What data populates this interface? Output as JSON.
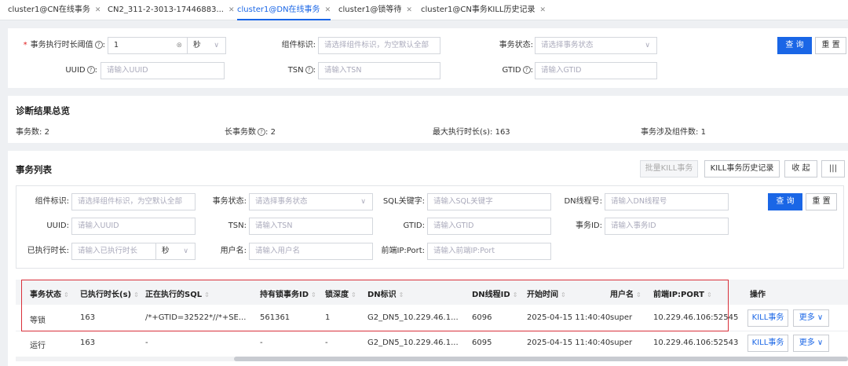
{
  "tabs": [
    {
      "label": "cluster1@CN在线事务"
    },
    {
      "label": "CN2_311-2-3013-17446883..."
    },
    {
      "label": "cluster1@DN在线事务"
    },
    {
      "label": "cluster1@锁等待"
    },
    {
      "label": "cluster1@CN事务KILL历史记录"
    }
  ],
  "top_filter": {
    "threshold_label": "事务执行时长阈值",
    "threshold_value": "1",
    "unit_value": "秒",
    "component_label": "组件标识:",
    "component_placeholder": "请选择组件标识，为空默认全部",
    "status_label": "事务状态:",
    "status_placeholder": "请选择事务状态",
    "query_label": "查 询",
    "reset_label": "重 置",
    "uuid_label": "UUID",
    "uuid_placeholder": "请输入UUID",
    "tsn_label": "TSN",
    "tsn_placeholder": "请输入TSN",
    "gtid_label": "GTID",
    "gtid_placeholder": "请输入GTID"
  },
  "summary": {
    "title": "诊断结果总览",
    "txn_count_label": "事务数:",
    "txn_count": "2",
    "long_txn_label": "长事务数",
    "long_txn_count": "2",
    "max_exec_label": "最大执行时长(s):",
    "max_exec": "163",
    "component_count_label": "事务涉及组件数:",
    "component_count": "1"
  },
  "list": {
    "title": "事务列表",
    "batch_kill_label": "批量KILL事务",
    "kill_history_label": "KILL事务历史记录",
    "collapse_label": "收 起",
    "columns_icon": "|||",
    "filter": {
      "component_label": "组件标识:",
      "component_placeholder": "请选择组件标识，为空默认全部",
      "status_label": "事务状态:",
      "status_placeholder": "请选择事务状态",
      "sql_label": "SQL关键字:",
      "sql_placeholder": "请输入SQL关键字",
      "dn_thread_label": "DN线程号:",
      "dn_thread_placeholder": "请输入DN线程号",
      "query_label": "查 询",
      "reset_label": "重 置",
      "uuid_label": "UUID:",
      "uuid_placeholder": "请输入UUID",
      "tsn_label": "TSN:",
      "tsn_placeholder": "请输入TSN",
      "gtid_label": "GTID:",
      "gtid_placeholder": "请输入GTID",
      "txid_label": "事务ID:",
      "txid_placeholder": "请输入事务ID",
      "exec_label": "已执行时长:",
      "exec_placeholder": "请输入已执行时长",
      "exec_unit": "秒",
      "user_label": "用户名:",
      "user_placeholder": "请输入用户名",
      "ip_label": "前端IP:Port:",
      "ip_placeholder": "请输入前端IP:Port"
    },
    "columns": [
      "事务状态",
      "已执行时长(s)",
      "正在执行的SQL",
      "持有锁事务ID",
      "锁深度",
      "DN标识",
      "DN线程ID",
      "开始时间",
      "用户名",
      "前端IP:PORT",
      "操作"
    ],
    "rows": [
      {
        "status": "等锁",
        "exec": "163",
        "sql": "/*+GTID=32522*//*+SE...",
        "lock_txid": "561361",
        "depth": "1",
        "dn": "G2_DN5_10.229.46.1...",
        "thread": "6096",
        "start": "2025-04-15 11:40:40",
        "user": "super",
        "ip": "10.229.46.106:52545",
        "kill": "KILL事务",
        "more": "更多"
      },
      {
        "status": "运行",
        "exec": "163",
        "sql": "-",
        "lock_txid": "-",
        "depth": "-",
        "dn": "G2_DN5_10.229.46.1...",
        "thread": "6095",
        "start": "2025-04-15 11:40:40",
        "user": "super",
        "ip": "10.229.46.106:52543",
        "kill": "KILL事务",
        "more": "更多"
      }
    ]
  }
}
